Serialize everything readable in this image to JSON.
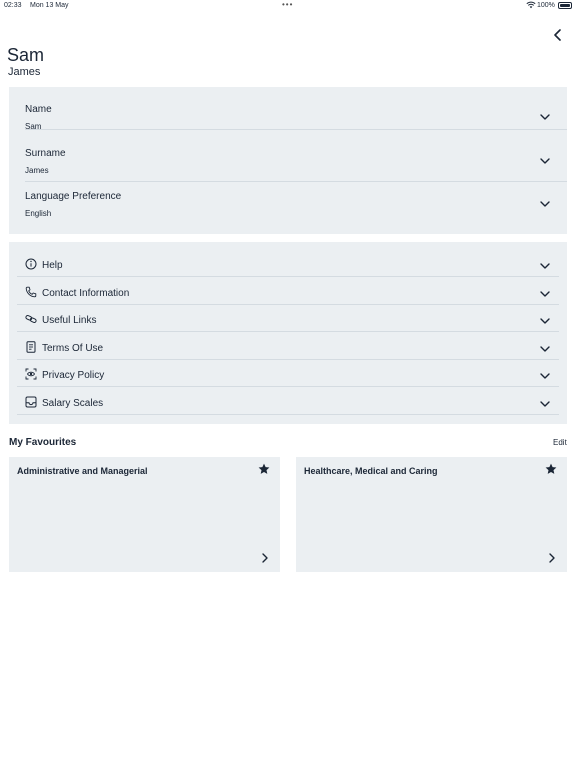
{
  "status": {
    "time": "02:33",
    "date": "Mon 13 May",
    "dots": "•••",
    "battery": "100%"
  },
  "profile": {
    "first_name": "Sam",
    "last_name": "James"
  },
  "details": [
    {
      "label": "Name",
      "value": "Sam"
    },
    {
      "label": "Surname",
      "value": "James"
    },
    {
      "label": "Language Preference",
      "value": "English"
    }
  ],
  "menu": [
    {
      "label": "Help",
      "icon": "info-icon"
    },
    {
      "label": "Contact Information",
      "icon": "phone-icon"
    },
    {
      "label": "Useful Links",
      "icon": "link-icon"
    },
    {
      "label": "Terms Of Use",
      "icon": "document-icon"
    },
    {
      "label": "Privacy Policy",
      "icon": "privacy-icon"
    },
    {
      "label": "Salary Scales",
      "icon": "inbox-icon"
    }
  ],
  "favourites": {
    "title": "My Favourites",
    "edit_label": "Edit",
    "items": [
      {
        "name": "Administrative and Managerial"
      },
      {
        "name": "Healthcare, Medical and Caring"
      }
    ]
  },
  "colors": {
    "text": "#1b2636",
    "card_bg": "#ebeff2",
    "divider": "#d4dbe1"
  }
}
